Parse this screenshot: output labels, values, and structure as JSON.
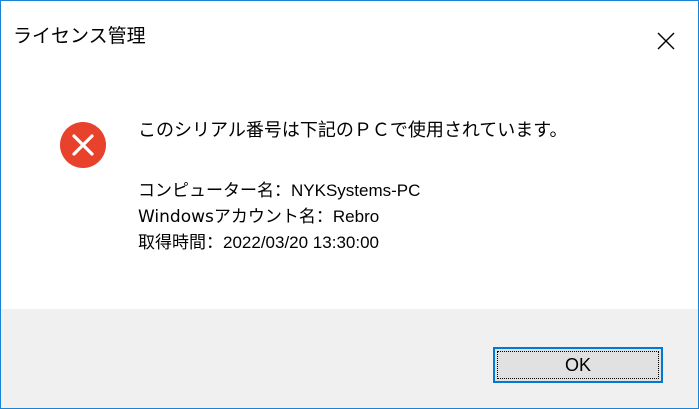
{
  "window": {
    "title": "ライセンス管理",
    "close_icon": "close-icon"
  },
  "dialog": {
    "icon": "error-icon",
    "icon_color": "#e8412c",
    "message": "このシリアル番号は下記のＰＣで使用されています。",
    "details": [
      {
        "label": "コンピューター名：",
        "value": "NYKSystems-PC"
      },
      {
        "label": "Windowsアカウント名：",
        "value": "Rebro"
      },
      {
        "label": "取得時間：",
        "value": "2022/03/20 13:30:00"
      }
    ]
  },
  "buttons": {
    "ok_label": "OK"
  },
  "colors": {
    "window_border": "#1883d7",
    "footer_background": "#f0f0f0",
    "button_border": "#0078d7",
    "button_background": "#e1e1e1"
  }
}
